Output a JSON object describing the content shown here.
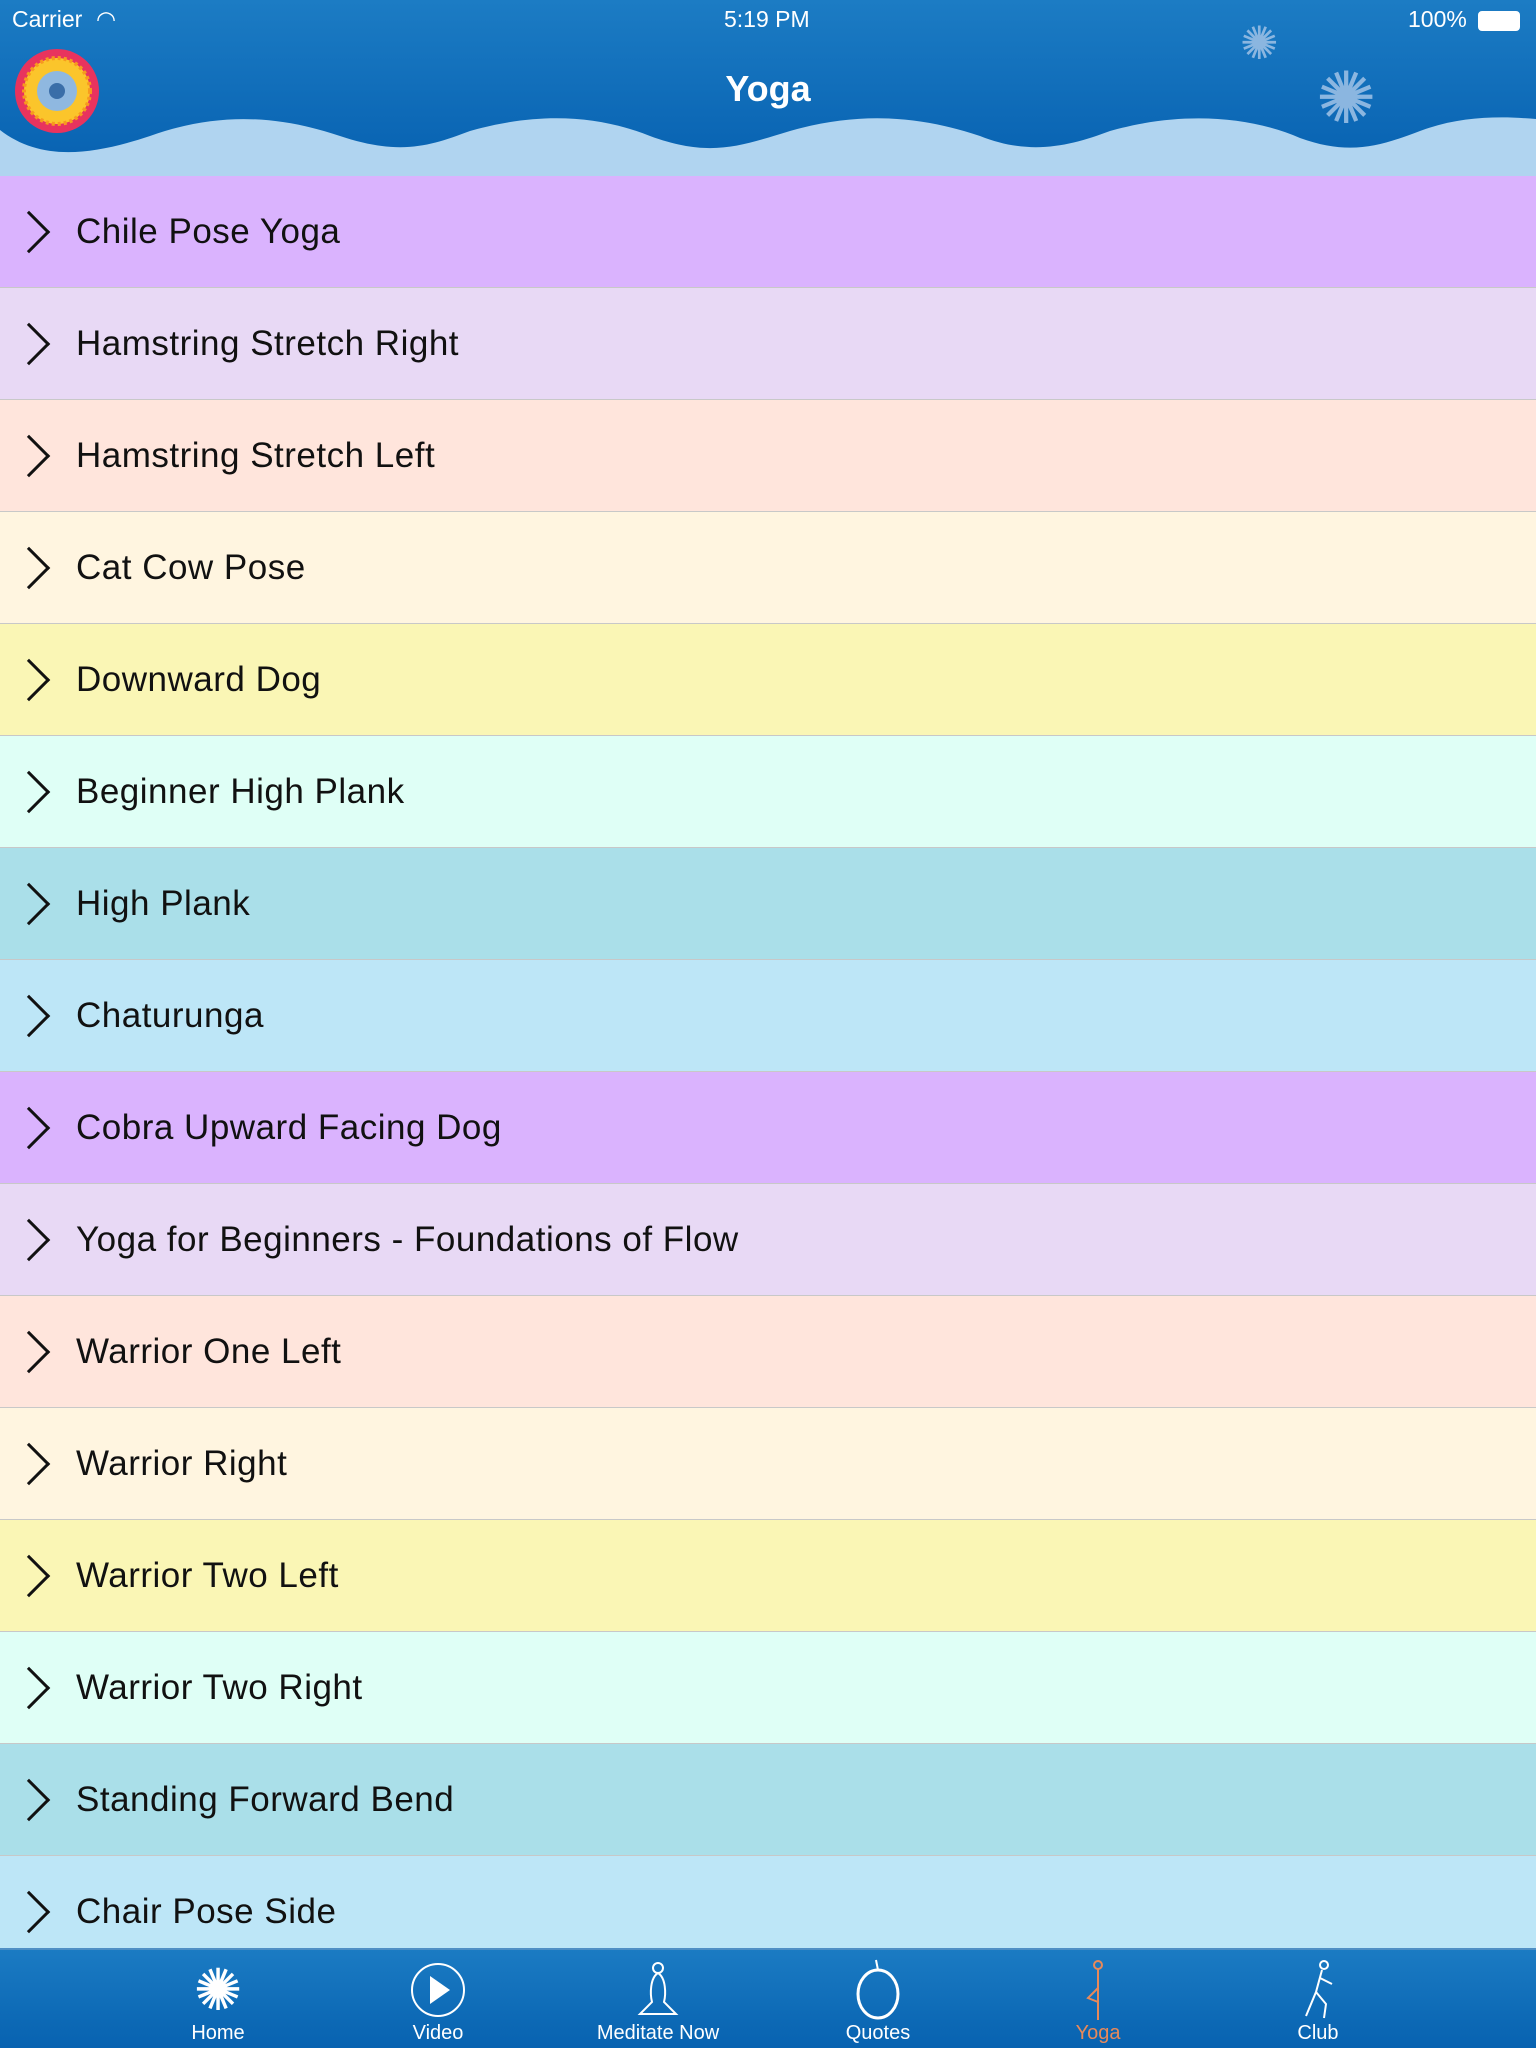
{
  "status": {
    "carrier": "Carrier",
    "time": "5:19 PM",
    "battery": "100%"
  },
  "header": {
    "title": "Yoga"
  },
  "colors": {
    "header": "#0f6fbb",
    "active_tab": "#e8895a"
  },
  "items": [
    {
      "label": "Chile Pose Yoga",
      "color": "#dab3fe"
    },
    {
      "label": "Hamstring Stretch Right",
      "color": "#e8d9f5"
    },
    {
      "label": "Hamstring Stretch Left",
      "color": "#ffe5dc"
    },
    {
      "label": "Cat Cow Pose",
      "color": "#fff5e0"
    },
    {
      "label": "Downward Dog",
      "color": "#faf6b5"
    },
    {
      "label": "Beginner High Plank",
      "color": "#dffff6"
    },
    {
      "label": "High Plank",
      "color": "#aadfe9"
    },
    {
      "label": "Chaturunga",
      "color": "#bde6f7"
    },
    {
      "label": "Cobra Upward Facing Dog",
      "color": "#dab3fe"
    },
    {
      "label": "Yoga for Beginners - Foundations of Flow",
      "color": "#e8d9f5"
    },
    {
      "label": "Warrior One Left",
      "color": "#ffe5dc"
    },
    {
      "label": "Warrior Right",
      "color": "#fff5e0"
    },
    {
      "label": "Warrior Two Left",
      "color": "#faf6b5"
    },
    {
      "label": "Warrior Two Right",
      "color": "#dffff6"
    },
    {
      "label": "Standing Forward Bend",
      "color": "#aadfe9"
    },
    {
      "label": "Chair Pose Side",
      "color": "#bde6f7"
    }
  ],
  "tabs": [
    {
      "label": "Home",
      "icon": "flower-icon"
    },
    {
      "label": "Video",
      "icon": "play-icon"
    },
    {
      "label": "Meditate Now",
      "icon": "meditate-icon"
    },
    {
      "label": "Quotes",
      "icon": "apple-icon"
    },
    {
      "label": "Yoga",
      "icon": "yoga-pose-icon",
      "active": true
    },
    {
      "label": "Club",
      "icon": "runner-icon"
    }
  ]
}
